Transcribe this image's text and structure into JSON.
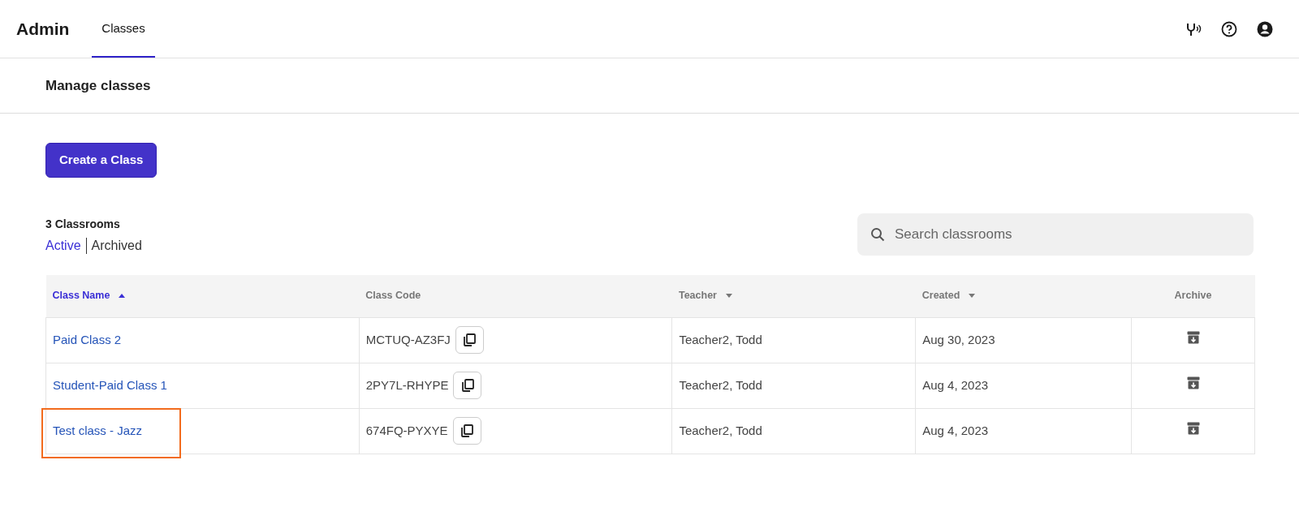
{
  "app": {
    "title": "Admin"
  },
  "tabs": [
    {
      "label": "Classes",
      "selected": true
    }
  ],
  "page_header": {
    "title": "Manage classes"
  },
  "create_button": {
    "label": "Create a Class"
  },
  "summary": {
    "count": "3 Classrooms"
  },
  "filters": [
    {
      "label": "Active",
      "selected": true
    },
    {
      "label": "Archived",
      "selected": false
    }
  ],
  "search": {
    "placeholder": "Search classrooms"
  },
  "table": {
    "columns": [
      {
        "label": "Class Name",
        "sortable": true,
        "ascending": true,
        "selected": true
      },
      {
        "label": "Class Code",
        "sortable": false,
        "selected": false
      },
      {
        "label": "Teacher",
        "sortable": true,
        "ascending": false,
        "selected": false
      },
      {
        "label": "Created",
        "sortable": true,
        "ascending": false,
        "selected": false
      },
      {
        "label": "Archive",
        "sortable": false,
        "selected": false
      }
    ],
    "rows": [
      {
        "name": "Paid Class 2",
        "code": "MCTUQ-AZ3FJ",
        "teacher": "Teacher2, Todd",
        "created": "Aug 30, 2023",
        "highlighted": false
      },
      {
        "name": "Student-Paid Class 1",
        "code": "2PY7L-RHYPE",
        "teacher": "Teacher2, Todd",
        "created": "Aug 4, 2023",
        "highlighted": false
      },
      {
        "name": "Test class - Jazz",
        "code": "674FQ-PYXYE",
        "teacher": "Teacher2, Todd",
        "created": "Aug 4, 2023",
        "highlighted": true
      }
    ]
  }
}
